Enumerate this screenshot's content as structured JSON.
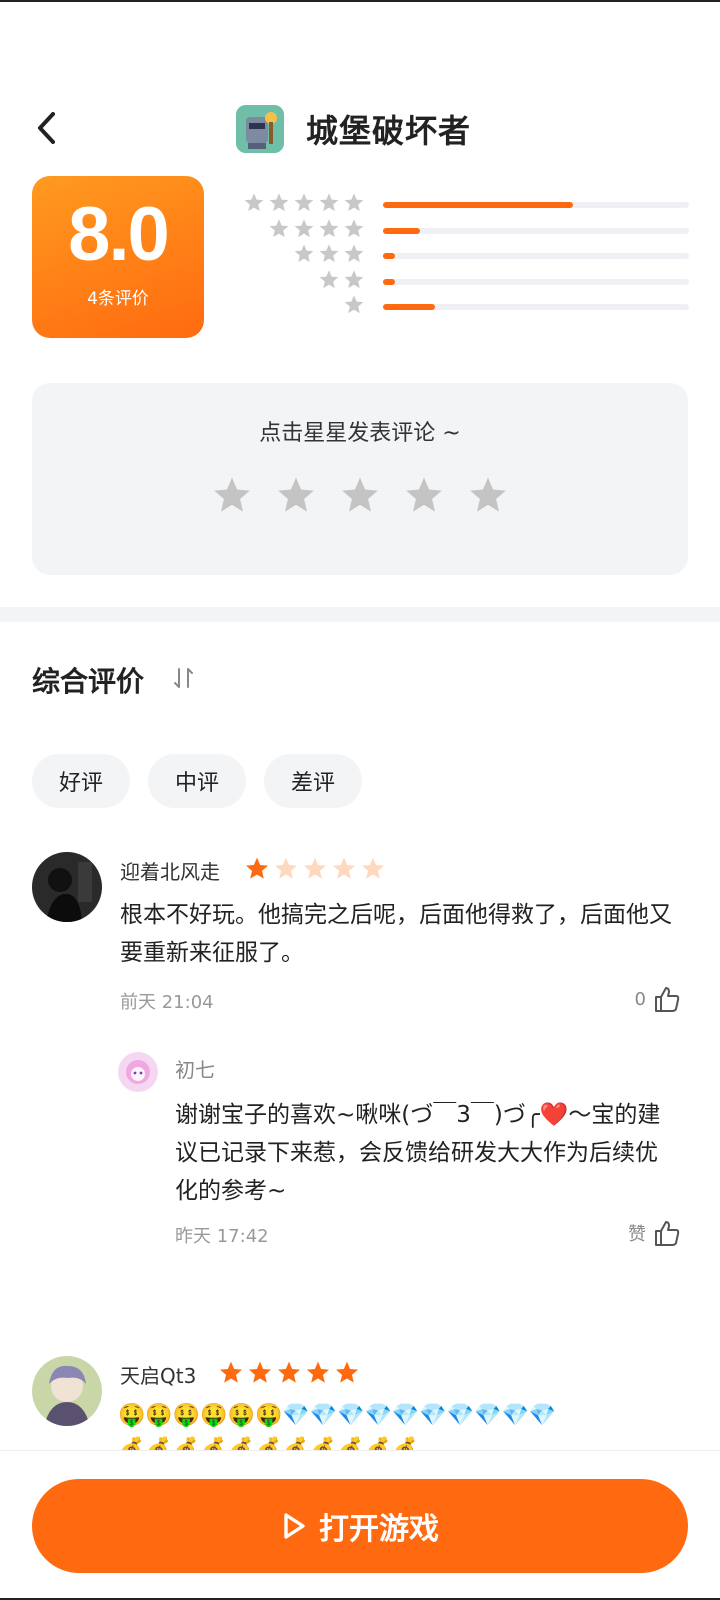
{
  "app": {
    "title": "城堡破坏者"
  },
  "rating": {
    "score": "8.0",
    "count_label": "4条评价",
    "distribution": [
      {
        "stars": 5,
        "fraction": 0.62
      },
      {
        "stars": 4,
        "fraction": 0.12
      },
      {
        "stars": 3,
        "fraction": 0.04
      },
      {
        "stars": 2,
        "fraction": 0.04
      },
      {
        "stars": 1,
        "fraction": 0.17
      }
    ]
  },
  "comment_card": {
    "prompt": "点击星星发表评论 ~"
  },
  "section": {
    "title": "综合评价"
  },
  "filters": [
    "好评",
    "中评",
    "差评"
  ],
  "reviews": [
    {
      "user": "迎着北风走",
      "stars": 1,
      "text": "根本不好玩。他搞完之后呢，后面他得救了，后面他又要重新来征服了。",
      "time": "前天 21:04",
      "likes": "0",
      "reply": {
        "user": "初七",
        "text": "谢谢宝子的喜欢~啾咪(づ￣3￣)づ╭❤️～宝的建议已记录下来惹，会反馈给研发大大作为后续优化的参考~",
        "time": "昨天 17:42",
        "like_label": "赞"
      }
    },
    {
      "user": "天启Qt3",
      "stars": 5,
      "emoji_line1": "🤑🤑🤑🤑🤑🤑💎💎💎💎💎💎💎💎💎💎",
      "emoji_line2": "💰💰💰💰💰💰💰💰💰💰💰"
    }
  ],
  "footer": {
    "open_button": "打开游戏"
  },
  "colors": {
    "accent": "#ff6a10",
    "star_gray": "#c8c8c8",
    "star_faded": "#ffd9bf"
  },
  "icons": [
    "back-arrow-icon",
    "game-icon",
    "star-icon",
    "sort-icon",
    "thumbs-up-icon",
    "play-icon"
  ]
}
